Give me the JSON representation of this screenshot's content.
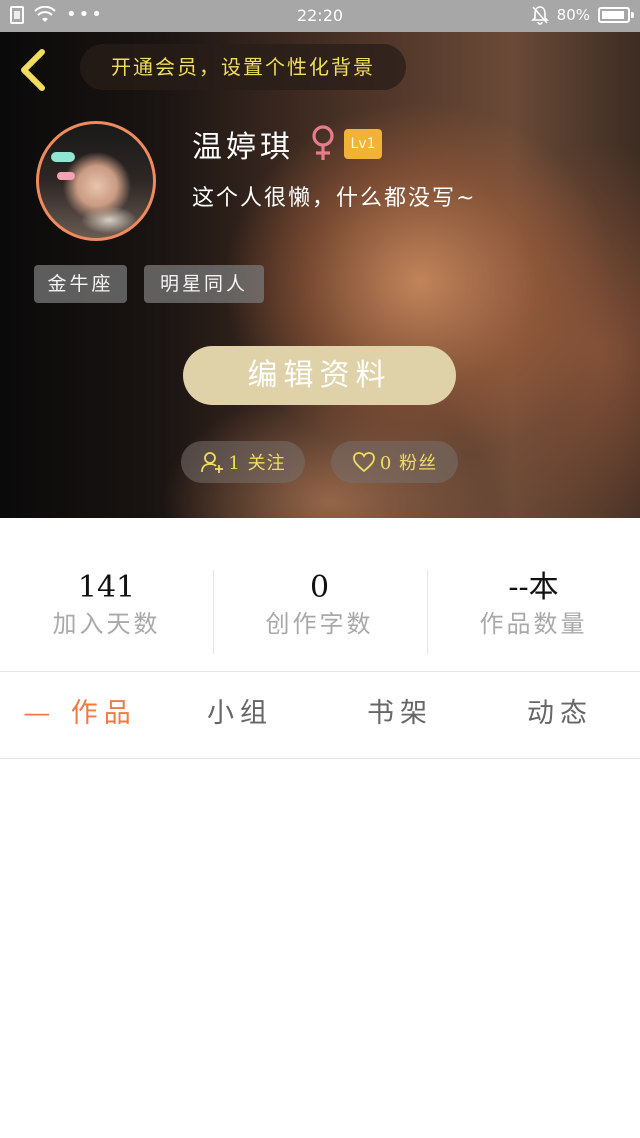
{
  "status_bar": {
    "time": "22:20",
    "battery": "80%",
    "icons": [
      "sim-icon",
      "wifi-icon",
      "more-dots-icon",
      "silent-bell-icon",
      "battery-icon"
    ]
  },
  "header": {
    "back_icon": "chevron-left-icon",
    "vip_banner": "开通会员，设置个性化背景",
    "username": "温婷琪",
    "gender_icon": "female-symbol-icon",
    "level": "Lv1",
    "bio": "这个人很懒，什么都没写~",
    "tags": [
      "金牛座",
      "明星同人"
    ],
    "edit_button": "编辑资料",
    "follow": {
      "icon": "user-add-icon",
      "label": "1 关注"
    },
    "fans": {
      "icon": "heart-icon",
      "label": "0 粉丝"
    },
    "colors": {
      "accent_yellow": "#f1dd5c",
      "avatar_ring": "#f08b5e",
      "edit_button": "#dfd2a9",
      "level_badge": "#f0b338"
    }
  },
  "stats": [
    {
      "value": "141",
      "label": "加入天数"
    },
    {
      "value": "0",
      "label": "创作字数"
    },
    {
      "value": "--本",
      "label": "作品数量"
    }
  ],
  "tabs": {
    "works": "— 作品 —",
    "group": "小组",
    "shelf": "书架",
    "feed": "动态",
    "active": "works",
    "active_color": "#f07a45"
  }
}
